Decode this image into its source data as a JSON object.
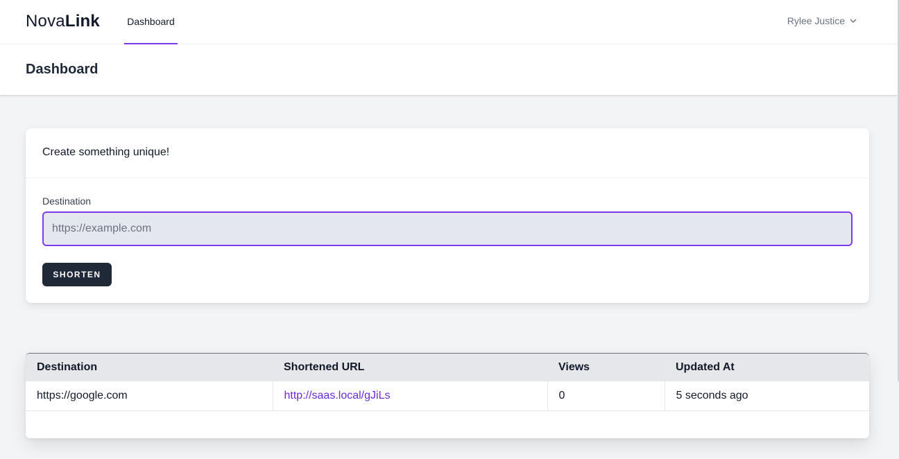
{
  "nav": {
    "brand_light": "Nova",
    "brand_bold": "Link",
    "tab_dashboard": "Dashboard",
    "user_name": "Rylee Justice",
    "user_icon": "chevron-down-icon"
  },
  "header": {
    "title": "Dashboard"
  },
  "create_card": {
    "heading": "Create something unique!",
    "field_label": "Destination",
    "input_value": "",
    "input_placeholder": "https://example.com",
    "button_label": "SHORTEN"
  },
  "table": {
    "columns": [
      "Destination",
      "Shortened URL",
      "Views",
      "Updated At"
    ],
    "rows": [
      {
        "destination": "https://google.com",
        "short_url": "http://saas.local/gJiLs",
        "views": "0",
        "updated_at": "5 seconds ago"
      }
    ]
  },
  "colors": {
    "accent": "#7c3aed",
    "link": "#6d28d9",
    "button_bg": "#1f2937",
    "page_bg": "#f3f4f6"
  }
}
